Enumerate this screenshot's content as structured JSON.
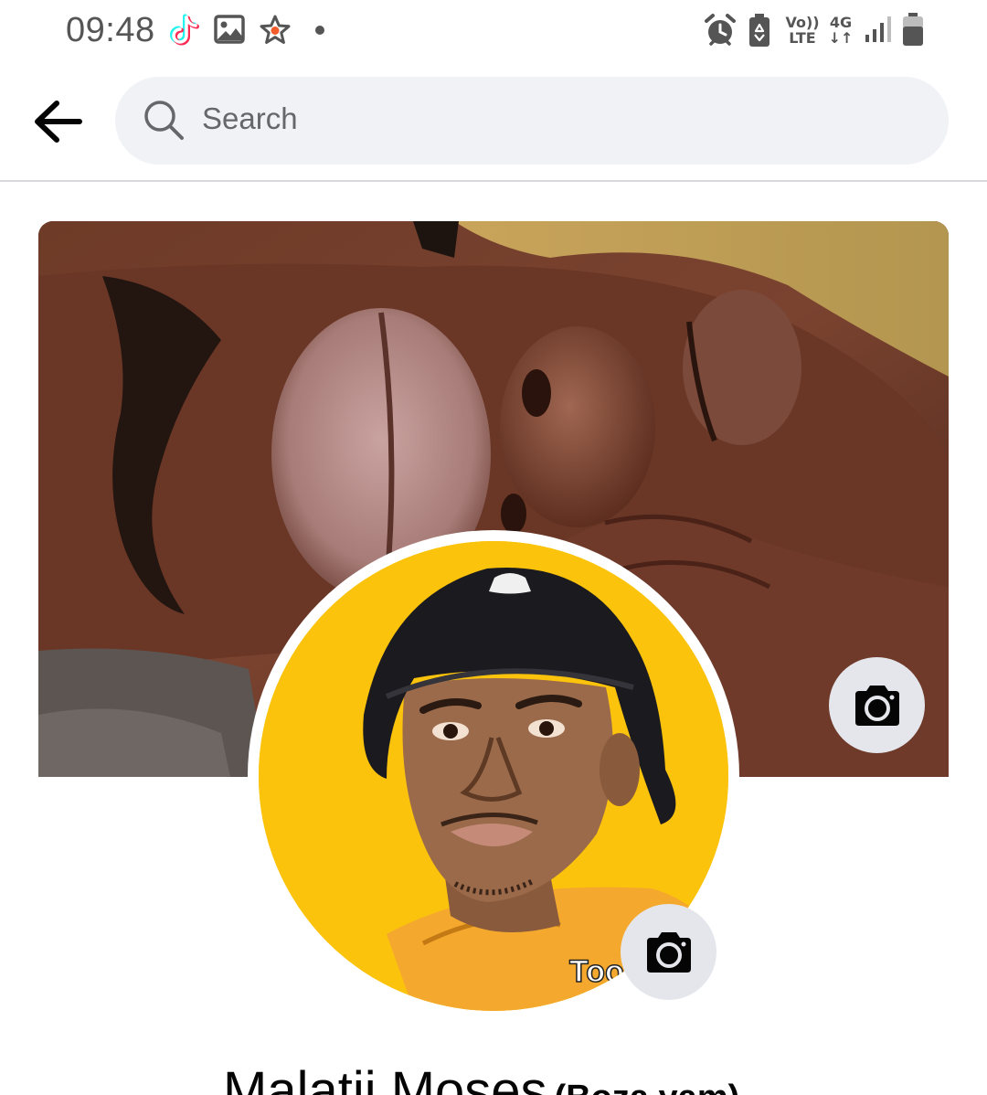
{
  "status_bar": {
    "time": "09:48",
    "notification_icons": [
      "tiktok-icon",
      "gallery-icon",
      "star-badge-icon",
      "dot-icon"
    ],
    "network": {
      "volte_top": "Vo))",
      "volte_bottom": "LTE",
      "data_type": "4G",
      "data_arrows": "↓↑"
    },
    "system_icons": [
      "alarm-icon",
      "battery-saver-icon",
      "signal-icon",
      "battery-icon"
    ]
  },
  "header": {
    "back_icon": "arrow-left-icon",
    "search_icon": "search-icon",
    "search_placeholder": "Search"
  },
  "profile": {
    "name": "Malatji Moses",
    "alternate_name": "(Boza yam)",
    "avatar_caption": "Too",
    "cover_camera_icon": "camera-icon",
    "avatar_camera_icon": "camera-icon"
  },
  "colors": {
    "search_background": "#f0f2f5",
    "placeholder": "#65676b",
    "camera_button": "#e4e6eb",
    "avatar_background": "#fcc30d",
    "status_icon": "#555555"
  }
}
